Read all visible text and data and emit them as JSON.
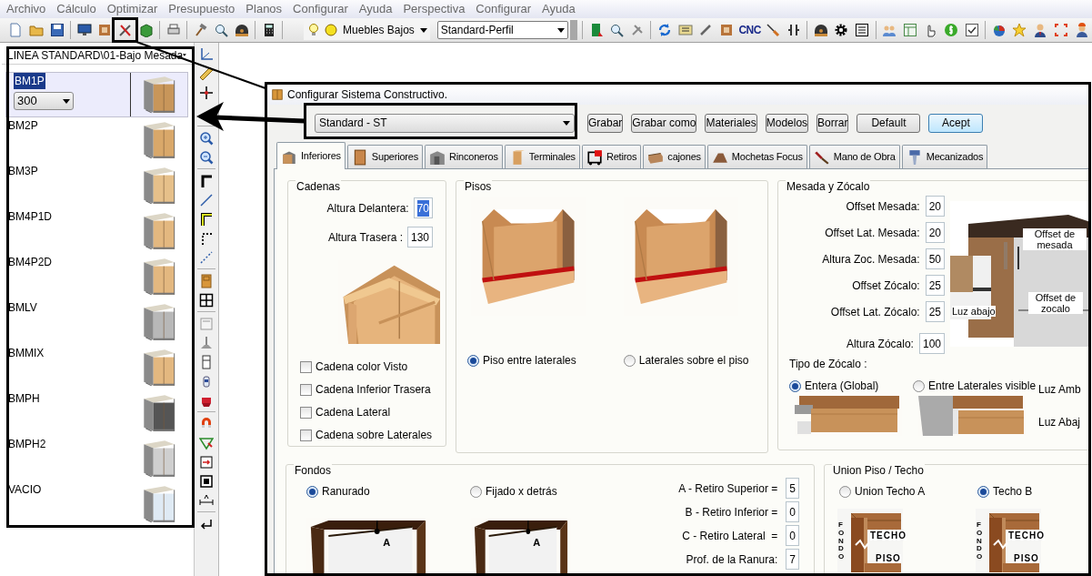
{
  "menu": [
    "Archivo",
    "Cálculo",
    "Optimizar",
    "Presupuesto",
    "Planos",
    "Configurar",
    "Ayuda",
    "Perspectiva",
    "Configurar",
    "Ayuda"
  ],
  "toolbar": {
    "type_combo": "Muebles Bajos",
    "profile_combo": "Standard-Perfil",
    "cnc_button": "CNC"
  },
  "library": {
    "path": "LINEA STANDARD\\01-Bajo Mesada",
    "items": [
      {
        "name": "BM1P",
        "selected": true,
        "size": "300"
      },
      {
        "name": "BM2P",
        "selected": false
      },
      {
        "name": "BM3P",
        "selected": false
      },
      {
        "name": "BM4P1D",
        "selected": false
      },
      {
        "name": "BM4P2D",
        "selected": false
      },
      {
        "name": "BMLV",
        "selected": false
      },
      {
        "name": "BMMIX",
        "selected": false
      },
      {
        "name": "BMPH",
        "selected": false
      },
      {
        "name": "BMPH2",
        "selected": false
      },
      {
        "name": "VACIO",
        "selected": false
      }
    ]
  },
  "dialog": {
    "title": "Configurar Sistema Constructivo.",
    "system": "Standard - ST",
    "buttons": [
      "Grabar",
      "Grabar como",
      "Materiales",
      "Modelos",
      "Borrar",
      "Default",
      "Acept"
    ],
    "tabs": [
      {
        "label": "Inferiores",
        "selected": true
      },
      {
        "label": "Superiores",
        "selected": false
      },
      {
        "label": "Rinconeros",
        "selected": false
      },
      {
        "label": "Terminales",
        "selected": false
      },
      {
        "label": "Retiros",
        "selected": false
      },
      {
        "label": "cajones",
        "selected": false
      },
      {
        "label": "Mochetas Focus",
        "selected": false
      },
      {
        "label": "Mano de Obra",
        "selected": false
      },
      {
        "label": "Mecanizados",
        "selected": false
      }
    ],
    "cadenas": {
      "title": "Cadenas",
      "fields": [
        {
          "label": "Altura Delantera:",
          "value": "70",
          "selected": true
        },
        {
          "label": "Altura Trasera :",
          "value": "130",
          "selected": false
        }
      ],
      "checks": [
        {
          "label": "Cadena color Visto",
          "checked": false
        },
        {
          "label": "Cadena Inferior Trasera",
          "checked": false
        },
        {
          "label": "Cadena Lateral",
          "checked": false
        },
        {
          "label": "Cadena sobre Laterales",
          "checked": false
        }
      ]
    },
    "pisos": {
      "title": "Pisos",
      "options": [
        {
          "label": "Piso entre laterales",
          "selected": true
        },
        {
          "label": "Laterales sobre el piso",
          "selected": false
        }
      ]
    },
    "mesada": {
      "title": "Mesada y Zócalo",
      "fields": [
        {
          "label": "Offset Mesada:",
          "value": "20"
        },
        {
          "label": "Offset Lat. Mesada:",
          "value": "20"
        },
        {
          "label": "Altura Zoc. Mesada:",
          "value": "50"
        },
        {
          "label": "Offset Zócalo:",
          "value": "25"
        },
        {
          "label": "Offset Lat. Zócalo:",
          "value": "25"
        },
        {
          "label": "Altura Zócalo:",
          "value": "100"
        }
      ],
      "diagram_labels": [
        "Offset de mesada",
        "Luz abajo",
        "Offset de zocalo"
      ],
      "zocalo_title": "Tipo de Zócalo :",
      "zocalo_options": [
        {
          "label": "Entera (Global)",
          "selected": true
        },
        {
          "label": "Entre Laterales visible",
          "selected": false
        }
      ],
      "side_labels": [
        "Luz Amb",
        "Luz Abaj"
      ]
    },
    "fondos": {
      "title": "Fondos",
      "options": [
        {
          "label": "Ranurado",
          "selected": true
        },
        {
          "label": "Fijado x detrás",
          "selected": false
        }
      ],
      "diagram_labels": [
        "A",
        "A"
      ],
      "fields": [
        {
          "label": "A - Retiro Superior =",
          "value": "5"
        },
        {
          "label": "B - Retiro Inferior =",
          "value": "0"
        },
        {
          "label": "C - Retiro Lateral  =",
          "value": "0"
        },
        {
          "label": "Prof. de la Ranura:",
          "value": "7"
        }
      ]
    },
    "union": {
      "title": "Union Piso / Techo",
      "options": [
        {
          "label": "Union Techo A",
          "selected": false,
          "diagram_labels": [
            "TECHO",
            "PISO",
            "FONDO"
          ]
        },
        {
          "label": "Techo B",
          "selected": true,
          "diagram_labels": [
            "TECHO",
            "PISO",
            "FONDO"
          ]
        }
      ]
    }
  }
}
